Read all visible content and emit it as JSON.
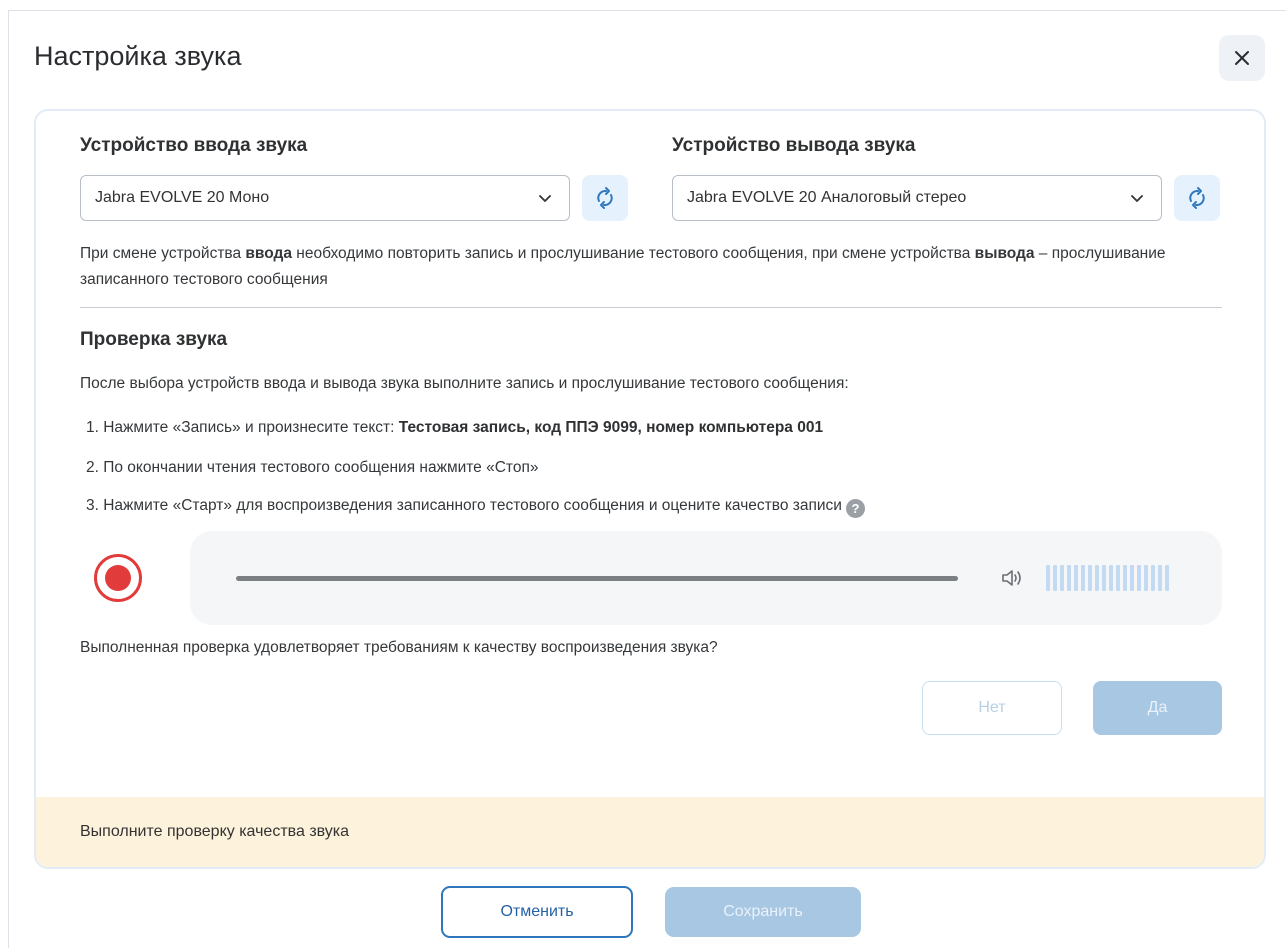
{
  "dialog": {
    "title": "Настройка звука",
    "close_label": "×"
  },
  "input_device": {
    "heading": "Устройство ввода звука",
    "selected": "Jabra EVOLVE 20 Моно"
  },
  "output_device": {
    "heading": "Устройство вывода звука",
    "selected": "Jabra EVOLVE 20 Аналоговый стерео"
  },
  "note": {
    "part1": "При смене устройства ",
    "bold1": "ввода",
    "part2": " необходимо повторить запись и прослушивание тестового сообщения, при смене устройства ",
    "bold2": "вывода",
    "part3": " – прослушивание записанного тестового сообщения"
  },
  "sound_check": {
    "heading": "Проверка звука",
    "intro": "После выбора устройств ввода и вывода звука выполните запись и прослушивание тестового сообщения:",
    "step1_text": "1. Нажмите «Запись» и произнесите текст: ",
    "step1_bold": "Тестовая запись, код ППЭ 9099, номер компьютера 001",
    "step2_text": "2. По окончании чтения тестового сообщения нажмите «Стоп»",
    "step3_text": "3. Нажмите «Старт» для воспроизведения записанного тестового сообщения и оцените качество записи",
    "help_glyph": "?",
    "question": "Выполненная проверка удовлетворяет требованиям к качеству воспроизведения звука?",
    "no_label": "Нет",
    "yes_label": "Да"
  },
  "warning": {
    "text": "Выполните проверку качества звука"
  },
  "footer": {
    "cancel_label": "Отменить",
    "save_label": "Сохранить"
  },
  "colors": {
    "primary": "#2f77bd",
    "disabled_primary": "#a7c7e3",
    "record": "#e23b3b",
    "warning_bg": "#fdf3dc",
    "level_bar": "#c3daf2"
  }
}
